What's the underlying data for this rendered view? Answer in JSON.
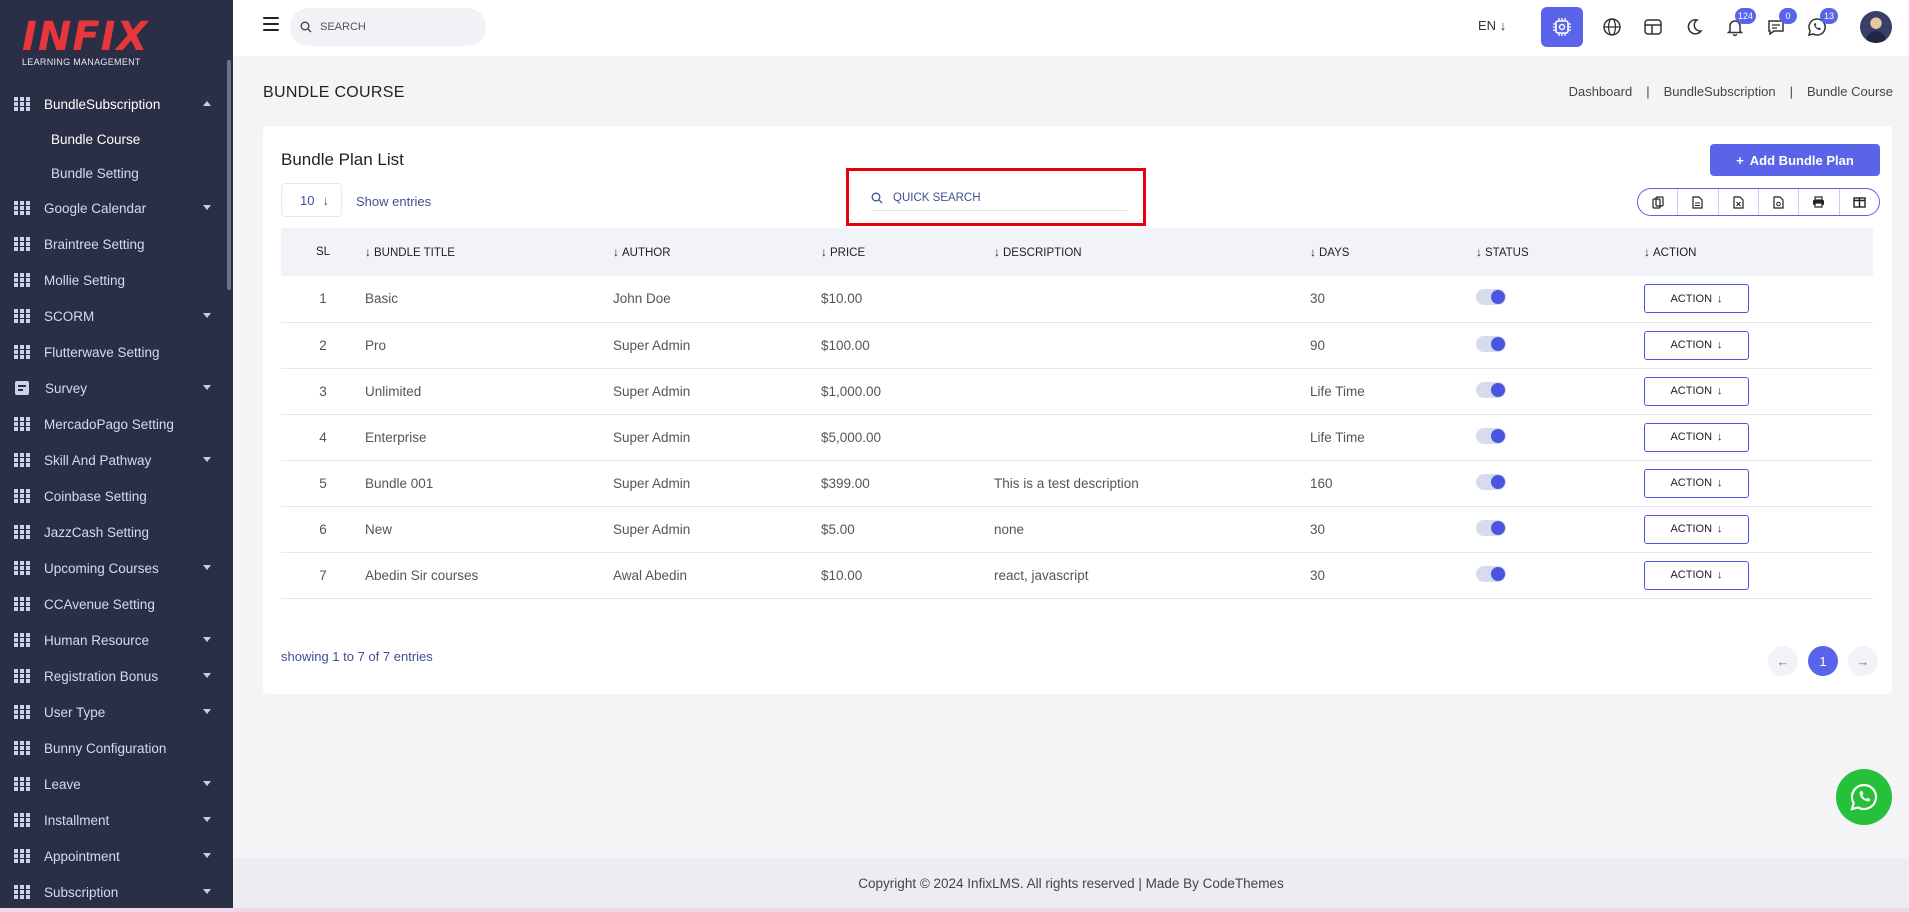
{
  "brand": {
    "logo_text": "INFIX",
    "tagline": "LEARNING MANAGEMENT"
  },
  "sidebar": {
    "items": [
      {
        "label": "BundleSubscription",
        "expanded": true
      },
      {
        "label": "Bundle Course",
        "sub": true,
        "current": true
      },
      {
        "label": "Bundle Setting",
        "sub": true
      },
      {
        "label": "Google Calendar",
        "caret": true
      },
      {
        "label": "Braintree Setting"
      },
      {
        "label": "Mollie Setting"
      },
      {
        "label": "SCORM",
        "caret": true
      },
      {
        "label": "Flutterwave Setting"
      },
      {
        "label": "Survey",
        "caret": true
      },
      {
        "label": "MercadoPago Setting"
      },
      {
        "label": "Skill And Pathway",
        "caret": true
      },
      {
        "label": "Coinbase Setting"
      },
      {
        "label": "JazzCash Setting"
      },
      {
        "label": "Upcoming Courses",
        "caret": true
      },
      {
        "label": "CCAvenue Setting"
      },
      {
        "label": "Human Resource",
        "caret": true
      },
      {
        "label": "Registration Bonus",
        "caret": true
      },
      {
        "label": "User Type",
        "caret": true
      },
      {
        "label": "Bunny Configuration"
      },
      {
        "label": "Leave",
        "caret": true
      },
      {
        "label": "Installment",
        "caret": true
      },
      {
        "label": "Appointment",
        "caret": true
      },
      {
        "label": "Subscription",
        "caret": true
      }
    ]
  },
  "topbar": {
    "search_placeholder": "SEARCH",
    "language": "EN",
    "notifications_count": "124",
    "messages_count": "0",
    "whatsapp_count": "13",
    "accent_color": "#5964e8"
  },
  "page": {
    "title": "BUNDLE COURSE",
    "breadcrumb": [
      "Dashboard",
      "BundleSubscription",
      "Bundle Course"
    ]
  },
  "card": {
    "title": "Bundle Plan List",
    "add_button": "Add Bundle Plan",
    "entries_value": "10",
    "entries_label": "Show entries",
    "quick_search_placeholder": "QUICK SEARCH",
    "export_buttons": [
      "copy-icon",
      "csv-icon",
      "excel-icon",
      "pdf-icon",
      "print-icon",
      "columns-icon"
    ]
  },
  "table": {
    "headers": [
      "SL",
      "BUNDLE TITLE",
      "AUTHOR",
      "PRICE",
      "DESCRIPTION",
      "DAYS",
      "STATUS",
      "ACTION"
    ],
    "action_label": "ACTION",
    "rows": [
      {
        "sl": "1",
        "title": "Basic",
        "author": "John Doe",
        "price": "$10.00",
        "description": "",
        "days": "30",
        "status": true
      },
      {
        "sl": "2",
        "title": "Pro",
        "author": "Super Admin",
        "price": "$100.00",
        "description": "",
        "days": "90",
        "status": true
      },
      {
        "sl": "3",
        "title": "Unlimited",
        "author": "Super Admin",
        "price": "$1,000.00",
        "description": "",
        "days": "Life Time",
        "status": true
      },
      {
        "sl": "4",
        "title": "Enterprise",
        "author": "Super Admin",
        "price": "$5,000.00",
        "description": "",
        "days": "Life Time",
        "status": true
      },
      {
        "sl": "5",
        "title": "Bundle 001",
        "author": "Super Admin",
        "price": "$399.00",
        "description": "This is a test description",
        "days": "160",
        "status": true
      },
      {
        "sl": "6",
        "title": "New",
        "author": "Super Admin",
        "price": "$5.00",
        "description": "none",
        "days": "30",
        "status": true
      },
      {
        "sl": "7",
        "title": "Abedin Sir courses",
        "author": "Awal Abedin",
        "price": "$10.00",
        "description": "react, javascript",
        "days": "30",
        "status": true
      }
    ]
  },
  "pagination": {
    "showing": "showing 1 to 7 of 7 entries",
    "current_page": "1"
  },
  "footer": {
    "text": "Copyright © 2024 InfixLMS. All rights reserved | Made By CodeThemes"
  }
}
